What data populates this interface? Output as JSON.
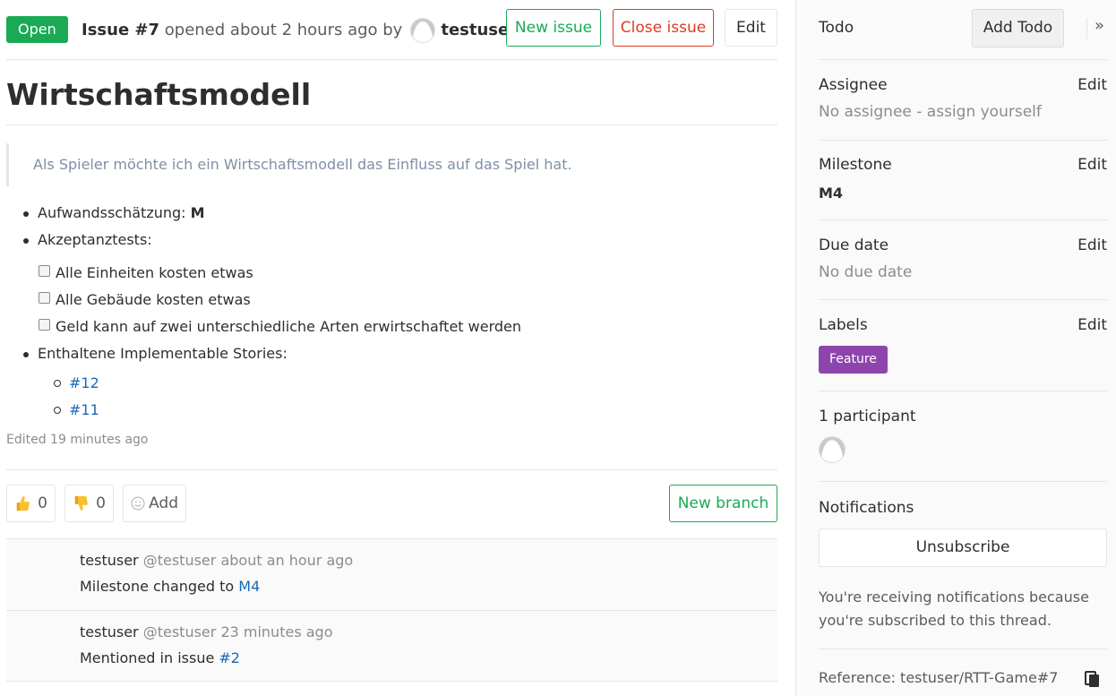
{
  "header": {
    "status": "Open",
    "issue_ref": "Issue #7",
    "opened_text": "opened about 2 hours ago by",
    "author": "testuser",
    "new_issue_label": "New issue",
    "close_issue_label": "Close issue",
    "edit_label": "Edit"
  },
  "issue": {
    "title": "Wirtschaftsmodell",
    "quote": "Als Spieler möchte ich ein Wirtschaftsmodell das Einfluss auf das Spiel hat.",
    "estimate_label": "Aufwandsschätzung:",
    "estimate_value": "M",
    "acceptance_label": "Akzeptanztests:",
    "tasks": [
      "Alle Einheiten kosten etwas",
      "Alle Gebäude kosten etwas",
      "Geld kann auf zwei unterschiedliche Arten erwirtschaftet werden"
    ],
    "stories_label": "Enthaltene Implementable Stories:",
    "stories": [
      "#12",
      "#11"
    ],
    "edited": "Edited 19 minutes ago"
  },
  "awards": {
    "thumbs_up_count": "0",
    "thumbs_down_count": "0",
    "add_label": "Add",
    "new_branch_label": "New branch"
  },
  "notes": [
    {
      "author": "testuser",
      "handle": "@testuser",
      "time": "about an hour ago",
      "text": "Milestone changed to",
      "link": "M4"
    },
    {
      "author": "testuser",
      "handle": "@testuser",
      "time": "23 minutes ago",
      "text": "Mentioned in issue",
      "link": "#2"
    }
  ],
  "sidebar": {
    "todo_label": "Todo",
    "add_todo_label": "Add Todo",
    "collapse_glyph": "»",
    "edit_label": "Edit",
    "assignee_title": "Assignee",
    "assignee_value": "No assignee - assign yourself",
    "milestone_title": "Milestone",
    "milestone_value": "M4",
    "due_title": "Due date",
    "due_value": "No due date",
    "labels_title": "Labels",
    "label_feature": "Feature",
    "participants_title": "1 participant",
    "notifications_title": "Notifications",
    "unsubscribe_label": "Unsubscribe",
    "notifications_text": "You're receiving notifications because you're subscribed to this thread.",
    "reference": "Reference: testuser/RTT-Game#7"
  },
  "colors": {
    "open_badge": "#1aaa55",
    "close_red": "#db3b21",
    "label_purple": "#8e44ad",
    "link_blue": "#1b69b6"
  }
}
